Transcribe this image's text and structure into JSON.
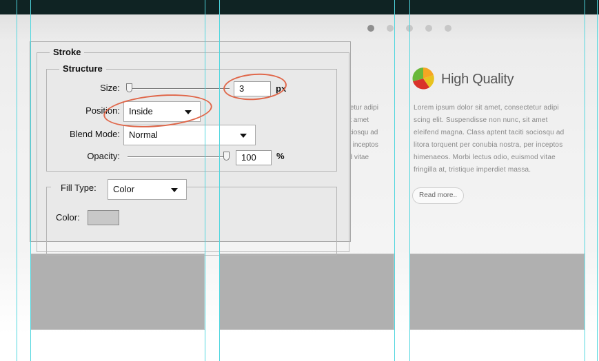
{
  "page": {
    "slider_dots": [
      {
        "active": true
      },
      {
        "active": false
      },
      {
        "active": false
      },
      {
        "active": false
      },
      {
        "active": false
      }
    ],
    "feature": {
      "icon": "pie-chart-icon",
      "title": "High Quality",
      "lines": [
        "Lorem ipsum dolor sit amet, consectetur adipi",
        "scing elit. Suspendisse non nunc, sit amet",
        "eleifend magna. Class aptent taciti sociosqu ad",
        "litora torquent per conubia nostra, per inceptos",
        "himenaeos. Morbi lectus odio, euismod vitae",
        "fringilla at, tristique imperdiet massa."
      ],
      "read_more": "Read more.."
    },
    "column2_lines": [
      "ctetur adipi",
      "sit amet",
      "ociosqu ad",
      "er inceptos",
      "od vitae",
      "."
    ]
  },
  "dialog": {
    "section": "Stroke",
    "structure": {
      "legend": "Structure",
      "size_label": "Size:",
      "size_value": "3",
      "size_unit": "px",
      "position_label": "Position:",
      "position_value": "Inside",
      "blend_label": "Blend Mode:",
      "blend_value": "Normal",
      "opacity_label": "Opacity:",
      "opacity_value": "100",
      "opacity_unit": "%"
    },
    "fill": {
      "type_label": "Fill Type:",
      "type_value": "Color",
      "color_label": "Color:",
      "color_swatch": "#c8c8c8"
    }
  },
  "colors": {
    "topbar": "#0f2323",
    "guides": "#4fd6de",
    "highlight": "#e0674a"
  }
}
